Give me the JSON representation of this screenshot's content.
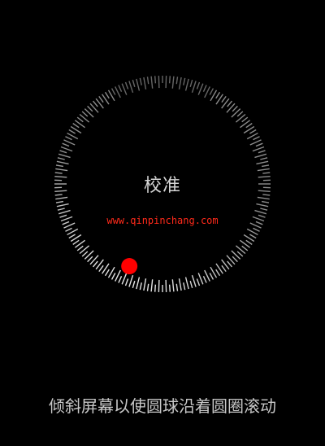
{
  "screen": {
    "title": "校准",
    "instruction": "倾斜屏幕以使圆球沿着圆圈滚动",
    "watermark": "www.qinpinchang.com"
  },
  "dial": {
    "tick_count": 180,
    "tick_color": "#ffffff",
    "filled_fraction_hint": "partial"
  },
  "ball": {
    "color": "#ff0000",
    "angle_deg": 112
  },
  "colors": {
    "background": "#000000",
    "title": "#d6d6d6",
    "instruction": "#c8c8c8",
    "watermark": "#ff2a1a"
  }
}
